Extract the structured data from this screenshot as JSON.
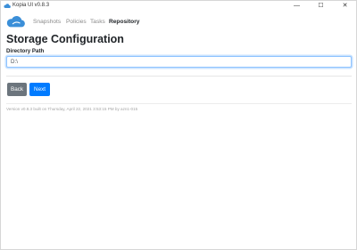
{
  "window": {
    "title": "Kopia UI v0.8.3",
    "minimize_glyph": "—",
    "maximize_glyph": "☐",
    "close_glyph": "✕"
  },
  "nav": {
    "items": [
      {
        "label": "Snapshots"
      },
      {
        "label": "Policies"
      },
      {
        "label": "Tasks"
      },
      {
        "label": "Repository",
        "active": true
      }
    ]
  },
  "page": {
    "title": "Storage Configuration",
    "directory_label": "Directory Path",
    "directory_value": "D:\\"
  },
  "buttons": {
    "back": "Back",
    "next": "Next"
  },
  "footer": {
    "version": "Version v0.8.3 built on Thursday, April 22, 2021 3:53:15 PM by azn1-015"
  },
  "colors": {
    "primary": "#007bff",
    "secondary": "#6c757d",
    "logo": "#3b8fd8"
  },
  "icons": {
    "app": "kopia-cloud-icon",
    "logo": "kopia-cloud-logo"
  }
}
